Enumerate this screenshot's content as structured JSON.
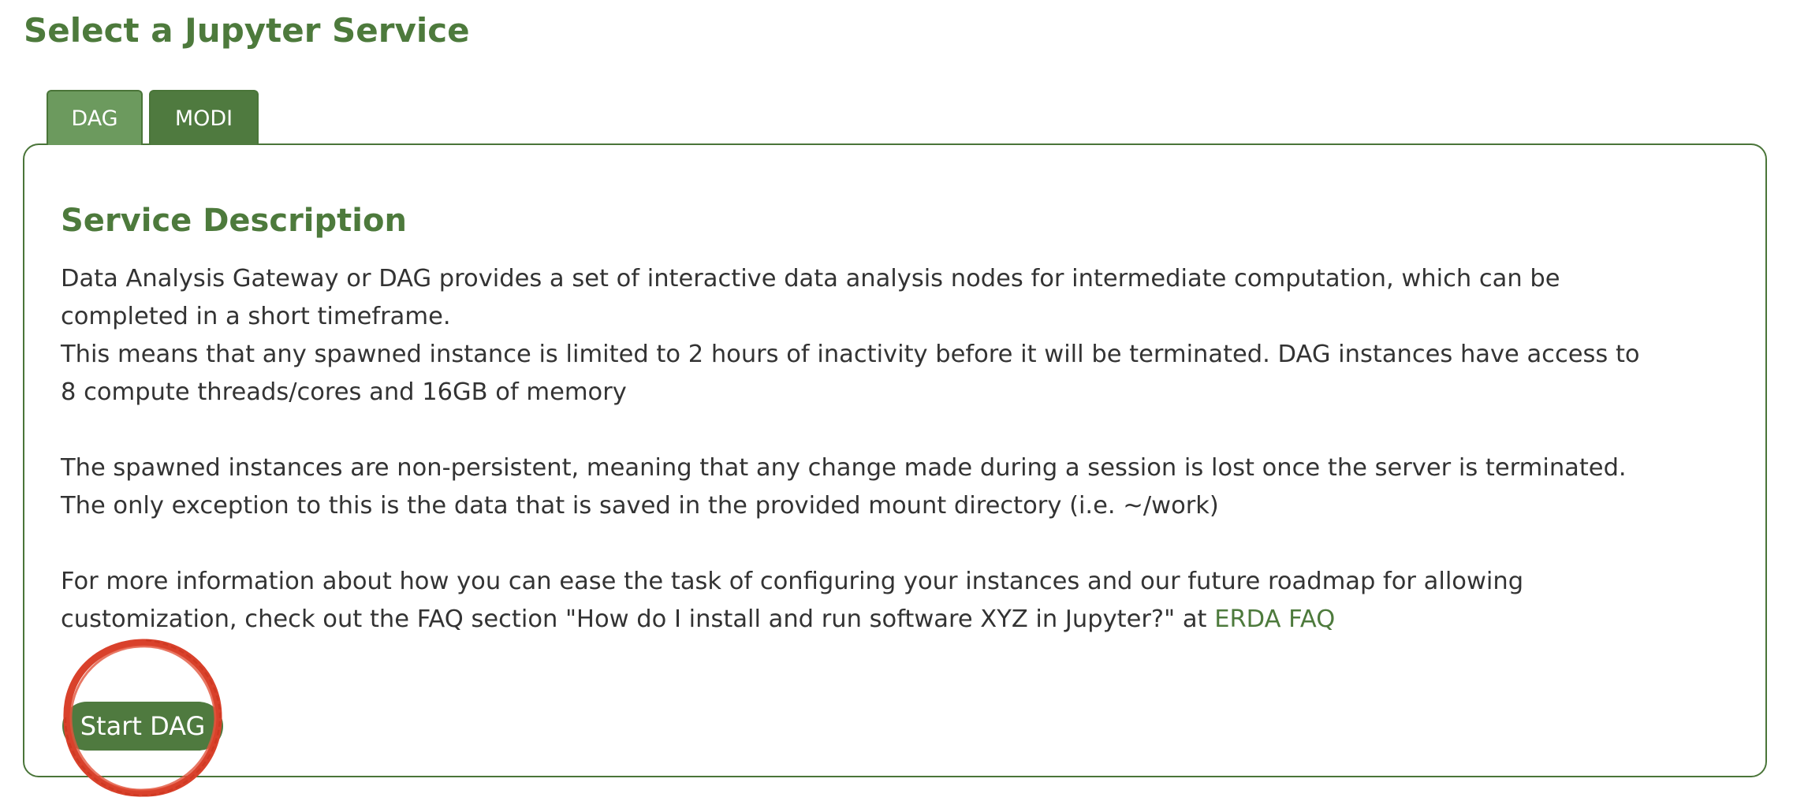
{
  "page": {
    "title": "Select a Jupyter Service"
  },
  "tabs": [
    {
      "label": "DAG",
      "active": true
    },
    {
      "label": "MODI",
      "active": false
    }
  ],
  "panel": {
    "heading": "Service Description",
    "paragraph1": [
      "Data Analysis Gateway or DAG provides a set of interactive data analysis nodes for intermediate computation, which can be",
      "completed in a short timeframe.",
      "This means that any spawned instance is limited to 2 hours of inactivity before it will be terminated. DAG instances have access to",
      "8 compute threads/cores and 16GB of memory"
    ],
    "paragraph2": [
      "The spawned instances are non-persistent, meaning that any change made during a session is lost once the server is terminated.",
      "The only exception to this is the data that is saved in the provided mount directory (i.e. ~/work)"
    ],
    "paragraph3": {
      "line1": "For more information about how you can ease the task of configuring your instances and our future roadmap for allowing",
      "line2": "customization, check out the FAQ section \"How do I install and run software XYZ in Jupyter?\" at ",
      "link": "ERDA FAQ"
    },
    "start_button": "Start DAG"
  },
  "colors": {
    "accent": "#4d7a3c",
    "tab_active": "#6c9a5e",
    "tab_inactive": "#4f7a3f",
    "button": "#4f7a3f",
    "annotation_circle": "#d9412b"
  },
  "icons": {
    "annotation": "red-hand-drawn-circle-icon"
  }
}
